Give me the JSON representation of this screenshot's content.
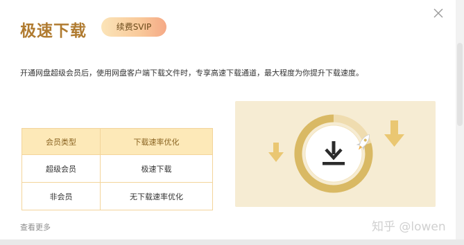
{
  "dialog": {
    "title": "极速下载",
    "renew_label": "续费SVIP",
    "description": "开通网盘超级会员后，使用网盘客户端下载文件时，专享高速下载通道，最大程度为你提升下载速度。",
    "more_label": "查看更多"
  },
  "table": {
    "headers": [
      "会员类型",
      "下载速率优化"
    ],
    "rows": [
      [
        "超级会员",
        "极速下载"
      ],
      [
        "非会员",
        "无下载速率优化"
      ]
    ]
  },
  "watermark": "知乎 @lowen",
  "colors": {
    "title": "#b07b30",
    "accent_gold": "#e2c27a",
    "table_header_bg": "#fde9b8",
    "illustration_bg": "#f6ecd3"
  },
  "icons": [
    "close-icon",
    "download-icon",
    "rocket-icon",
    "arrow-down-icon"
  ]
}
